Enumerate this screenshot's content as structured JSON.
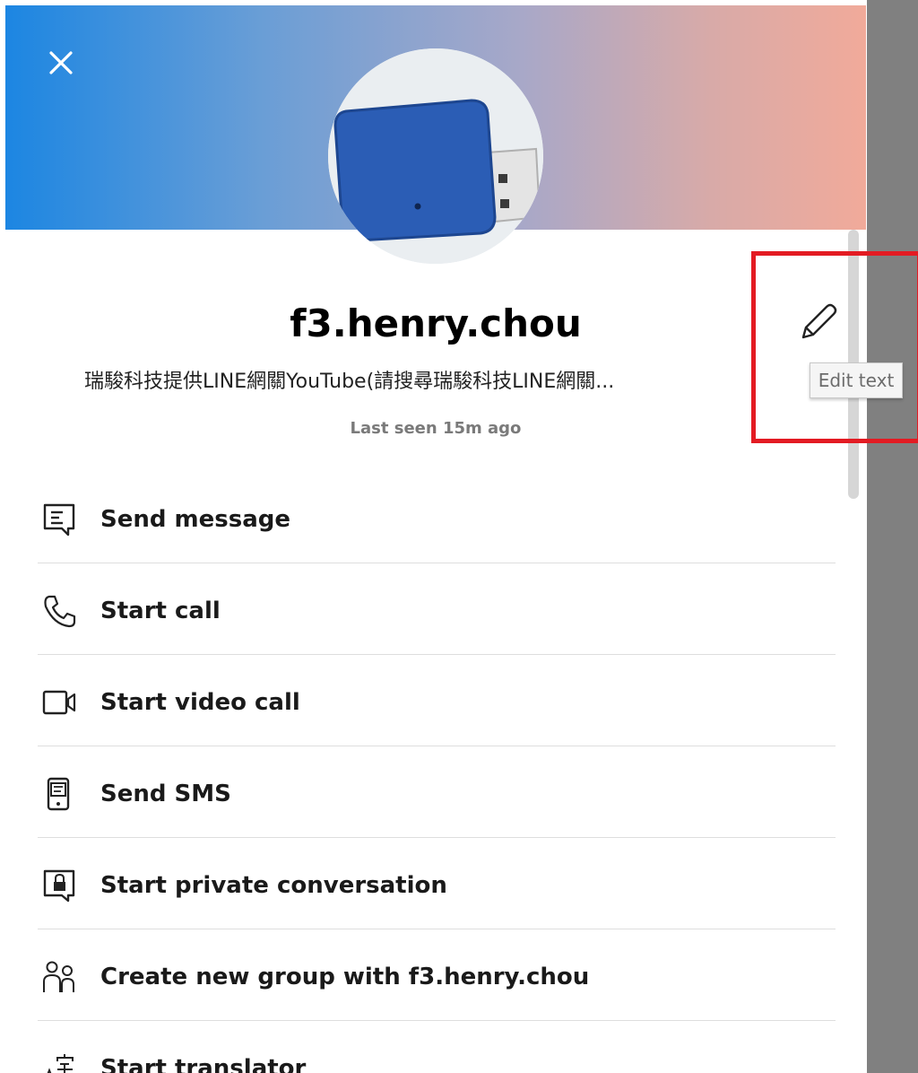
{
  "profile": {
    "name": "f3.henry.chou",
    "mood": "瑞駿科技提供LINE網關YouTube(請搜尋瑞駿科技LINE網關...",
    "last_seen": "Last seen 15m ago"
  },
  "tooltip": {
    "edit_text": "Edit text"
  },
  "icons": {
    "close": "close-icon",
    "edit": "pencil-icon"
  },
  "colors": {
    "header_gradient_start": "#1c86e2",
    "header_gradient_end": "#f1aa9a",
    "highlight_border": "#e31b23"
  },
  "menu": {
    "items": [
      {
        "label": "Send message",
        "icon": "message-icon"
      },
      {
        "label": "Start call",
        "icon": "phone-icon"
      },
      {
        "label": "Start video call",
        "icon": "video-camera-icon"
      },
      {
        "label": "Send SMS",
        "icon": "sms-icon"
      },
      {
        "label": "Start private conversation",
        "icon": "private-lock-icon"
      },
      {
        "label": "Create new group with f3.henry.chou",
        "icon": "people-group-icon"
      },
      {
        "label": "Start translator",
        "icon": "translator-icon"
      }
    ]
  }
}
